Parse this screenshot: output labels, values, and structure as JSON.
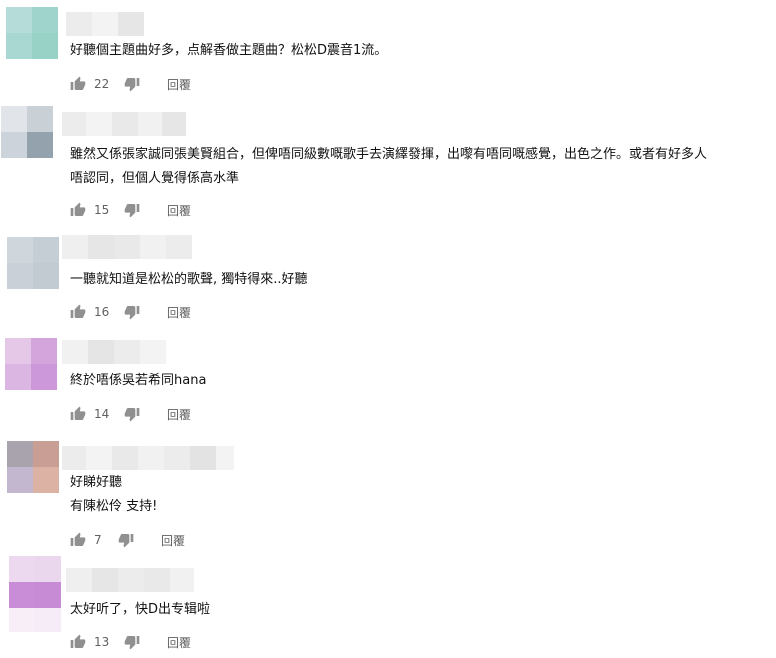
{
  "comments": [
    {
      "text": [
        "好聽個主題曲好多，点解香做主題曲？松松D震音1流。"
      ],
      "likes": "22",
      "reply": "回覆"
    },
    {
      "text": [
        "雖然又係張家誠同張美賢組合，但俾唔同級數嘅歌手去演繹發揮，出嚟有唔同嘅感覺，出色之作。或者有好多人",
        "唔認同，但個人覺得係高水準"
      ],
      "likes": "15",
      "reply": "回覆"
    },
    {
      "text": [
        "一聽就知道是松松的歌聲, 獨特得來..好聽"
      ],
      "likes": "16",
      "reply": "回覆"
    },
    {
      "text": [
        "終於唔係吳若希同hana"
      ],
      "likes": "14",
      "reply": "回覆"
    },
    {
      "text": [
        "好睇好聽",
        "有陳松伶 支持!"
      ],
      "likes": "7",
      "reply": "回覆"
    },
    {
      "text": [
        "太好听了，快D出专辑啦"
      ],
      "likes": "13",
      "reply": "回覆"
    }
  ],
  "colors": {
    "text": "#111111",
    "meta": "#606060",
    "icon": "#909090"
  },
  "icons": {
    "like": "thumb-up-icon",
    "dislike": "thumb-down-icon"
  }
}
